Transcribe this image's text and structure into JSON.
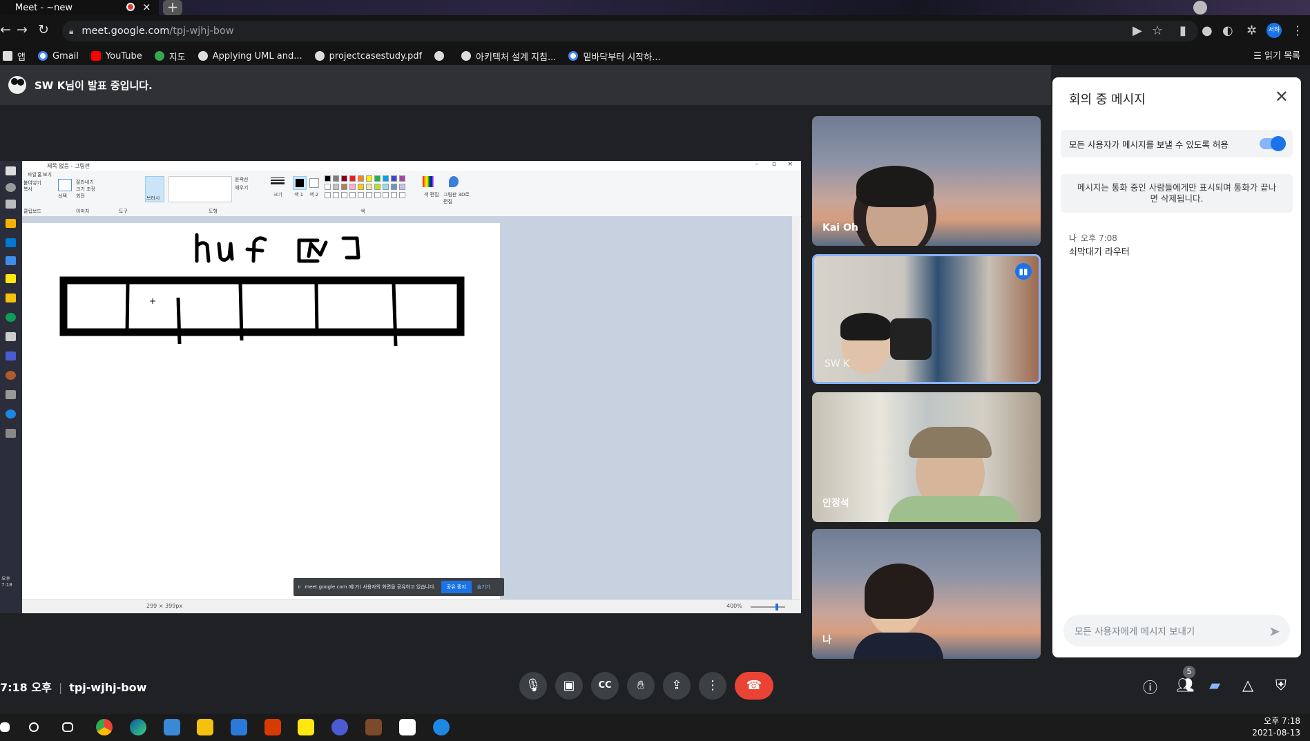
{
  "browser": {
    "tab_title": "Meet - ~new",
    "url_host": "meet.google.com",
    "url_path": "/tpj-wjhj-bow",
    "new_tab": "+",
    "bookmarks": [
      {
        "label": "앱",
        "color": "#4285f4"
      },
      {
        "label": "Gmail",
        "color": "#ea4335"
      },
      {
        "label": "YouTube",
        "color": "#ff0000"
      },
      {
        "label": "지도",
        "color": "#34a853"
      },
      {
        "label": "Applying UML and...",
        "color": "#dddddd"
      },
      {
        "label": "projectcasestudy.pdf",
        "color": "#dddddd"
      },
      {
        "label": "",
        "color": "#dddddd"
      },
      {
        "label": "아키텍처 설계 지침...",
        "color": "#dddddd"
      },
      {
        "label": "밑바닥부터 시작하...",
        "color": "#4285f4"
      }
    ],
    "reading_list": "읽기 목록",
    "profile": "서하"
  },
  "presenter_bar": {
    "text": "SW K님이 발표 중입니다."
  },
  "shared_screen": {
    "paint_title": "제목 없음 - 그림판",
    "ribbon_tabs": [
      "파일",
      "홈",
      "보기"
    ],
    "ribbon_groups": [
      "클립보드",
      "이미지",
      "도구",
      "도형",
      "색"
    ],
    "ribbon_labels": [
      "붙여넣기",
      "잘라내기",
      "복사",
      "선택",
      "크기 조정",
      "회전",
      "브러시",
      "윤곽선",
      "채우기",
      "크기",
      "색 1",
      "색 2",
      "색 편집",
      "그림판 3D로 편집"
    ],
    "canvas_size": "299 × 399px",
    "zoom": "400%",
    "share_notice": "meet.google.com 에(가) 사용자의 화면을 공유하고 있습니다.",
    "share_stop": "공유 중지",
    "share_hide": "숨기기",
    "sidebar_time": "오후 7:18",
    "palette": [
      "#000000",
      "#7f7f7f",
      "#880015",
      "#ed1c24",
      "#ff7f27",
      "#fff200",
      "#22b14c",
      "#00a2e8",
      "#3f48cc",
      "#a349a4",
      "#ffffff",
      "#c3c3c3",
      "#b97a57",
      "#ffaec9",
      "#ffc90e",
      "#efe4b0",
      "#b5e61d",
      "#99d9ea",
      "#7092be",
      "#c8bfe7"
    ]
  },
  "participants": [
    {
      "name": "Kai Oh",
      "speaking": false
    },
    {
      "name": "SW K",
      "speaking": true
    },
    {
      "name": "안정석",
      "speaking": false
    },
    {
      "name": "나",
      "speaking": false
    }
  ],
  "chat": {
    "title": "회의 중 메시지",
    "allow_text": "모든 사용자가 메시지를 보낼 수 있도록 허용",
    "allow_enabled": true,
    "info": "메시지는 통화 중인 사람들에게만 표시되며 통화가 끝나면 삭제됩니다.",
    "messages": [
      {
        "sender": "나",
        "time": "오후 7:08",
        "text": "쇠막대기 라우터"
      }
    ],
    "input_placeholder": "모든 사용자에게 메시지 보내기"
  },
  "meeting": {
    "time": "7:18 오후",
    "code": "tpj-wjhj-bow",
    "participant_count": "5"
  },
  "taskbar": {
    "time": "오후 7:18",
    "date": "2021-08-13"
  }
}
